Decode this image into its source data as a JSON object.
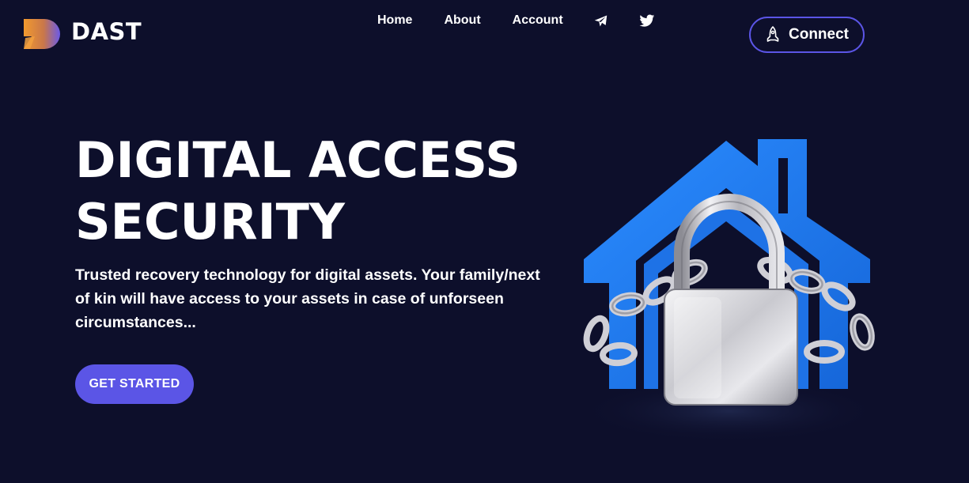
{
  "brand": {
    "name": "DAST",
    "logo_icon": "dast-logo-icon",
    "logo_colors": [
      "#f29a2e",
      "#6b5ae8"
    ]
  },
  "nav": {
    "home": "Home",
    "about": "About",
    "account": "Account",
    "telegram_icon": "telegram-icon",
    "twitter_icon": "twitter-icon"
  },
  "connect": {
    "label": "Connect",
    "icon": "rocket-icon"
  },
  "hero": {
    "title_line1": "DIGITAL ACCESS",
    "title_line2": "SECURITY",
    "description": "Trusted recovery technology for digital assets. Your family/next of kin will have access to your assets in case of unforseen circumstances...",
    "cta": "GET STARTED",
    "illustration": "house-padlock-chain-illustration"
  },
  "colors": {
    "background": "#0d0f2b",
    "accent": "#5b55e6",
    "house_blue": "#1e7ef0"
  }
}
